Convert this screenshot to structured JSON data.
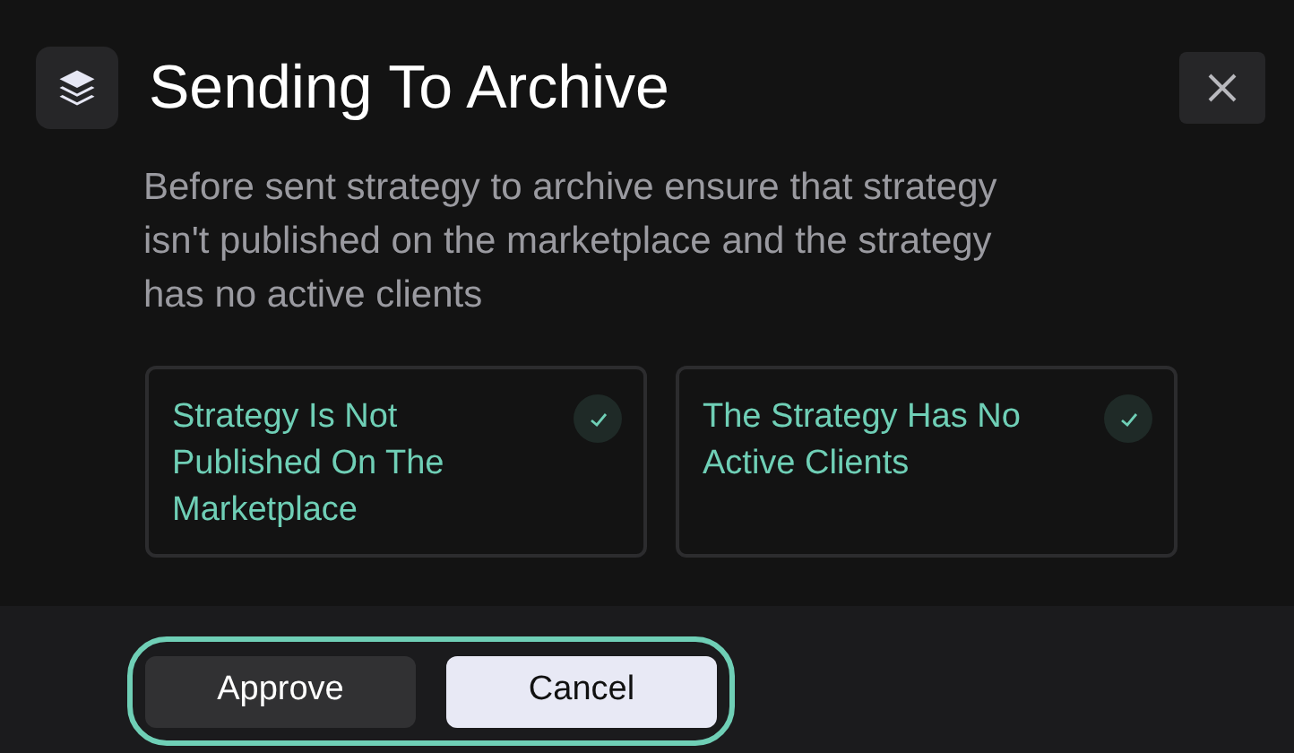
{
  "dialog": {
    "title": "Sending To Archive",
    "description": "Before sent strategy to archive ensure that strategy isn't published on the marketplace and the strategy has no active clients"
  },
  "conditions": [
    {
      "label": "Strategy Is Not Published On The Marketplace",
      "checked": true
    },
    {
      "label": "The Strategy Has No Active Clients",
      "checked": true
    }
  ],
  "buttons": [
    {
      "label": "Approve",
      "kind": "secondary"
    },
    {
      "label": "Cancel",
      "kind": "primary"
    }
  ]
}
